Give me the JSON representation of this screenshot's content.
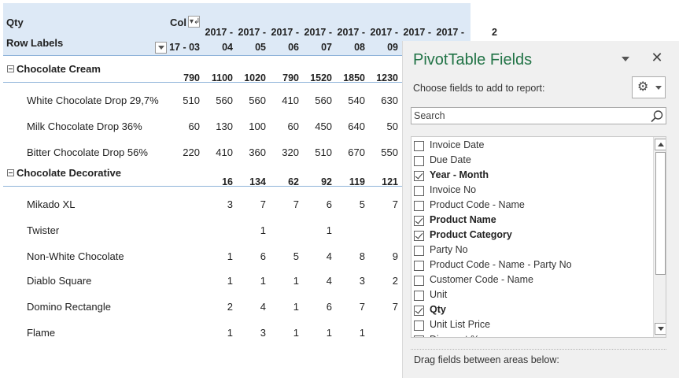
{
  "pivot": {
    "values_label": "Qty",
    "row_labels_header": "Row Labels",
    "column_labels_header": "Col",
    "columns": [
      {
        "year": "",
        "month": "17 - 03"
      },
      {
        "year": "2017 -",
        "month": "04"
      },
      {
        "year": "2017 -",
        "month": "05"
      },
      {
        "year": "2017 -",
        "month": "06"
      },
      {
        "year": "2017 -",
        "month": "07"
      },
      {
        "year": "2017 -",
        "month": "08"
      },
      {
        "year": "2017 -",
        "month": "09"
      },
      {
        "year": "2017 -",
        "month": ""
      },
      {
        "year": "2017 -",
        "month": ""
      },
      {
        "year": "2",
        "month": ""
      }
    ],
    "groups": [
      {
        "label": "Chocolate Cream",
        "values": [
          "790",
          "1100",
          "1020",
          "790",
          "1520",
          "1850",
          "1230"
        ],
        "items": [
          {
            "label": "White Chocolate Drop 29,7%",
            "values": [
              "510",
              "560",
              "560",
              "410",
              "560",
              "540",
              "630"
            ]
          },
          {
            "label": "Milk Chocolate Drop 36%",
            "values": [
              "60",
              "130",
              "100",
              "60",
              "450",
              "640",
              "50"
            ]
          },
          {
            "label": "Bitter Chocolate Drop 56%",
            "values": [
              "220",
              "410",
              "360",
              "320",
              "510",
              "670",
              "550"
            ]
          }
        ]
      },
      {
        "label": "Chocolate Decorative",
        "values": [
          "",
          "16",
          "134",
          "62",
          "92",
          "119",
          "121"
        ],
        "items": [
          {
            "label": "Mikado XL",
            "values": [
              "",
              "3",
              "7",
              "7",
              "6",
              "5",
              "7"
            ]
          },
          {
            "label": "Twister",
            "values": [
              "",
              "",
              "1",
              "",
              "1",
              "",
              ""
            ]
          },
          {
            "label": "Non-White Chocolate",
            "values": [
              "",
              "1",
              "6",
              "5",
              "4",
              "8",
              "9"
            ]
          },
          {
            "label": "Diablo Square",
            "values": [
              "",
              "1",
              "1",
              "1",
              "4",
              "3",
              "2"
            ]
          },
          {
            "label": "Domino Rectangle",
            "values": [
              "",
              "2",
              "4",
              "1",
              "6",
              "7",
              "7"
            ]
          },
          {
            "label": "Flame",
            "values": [
              "",
              "1",
              "3",
              "1",
              "1",
              "1",
              ""
            ]
          }
        ]
      }
    ]
  },
  "fields_pane": {
    "title": "PivotTable Fields",
    "choose_label": "Choose fields to add to report:",
    "search_placeholder": "Search",
    "close_glyph": "✕",
    "gear_glyph": "⚙",
    "fields": [
      {
        "label": "Invoice Date",
        "checked": false
      },
      {
        "label": "Due Date",
        "checked": false
      },
      {
        "label": "Year - Month",
        "checked": true
      },
      {
        "label": "Invoice No",
        "checked": false
      },
      {
        "label": "Product Code - Name",
        "checked": false
      },
      {
        "label": "Product Name",
        "checked": true
      },
      {
        "label": "Product Category",
        "checked": true
      },
      {
        "label": "Party No",
        "checked": false
      },
      {
        "label": "Product Code - Name - Party No",
        "checked": false
      },
      {
        "label": "Customer Code - Name",
        "checked": false
      },
      {
        "label": "Unit",
        "checked": false
      },
      {
        "label": "Qty",
        "checked": true
      },
      {
        "label": "Unit List Price",
        "checked": false
      },
      {
        "label": "Discount %",
        "checked": false
      }
    ],
    "drag_label": "Drag fields between areas below:"
  }
}
